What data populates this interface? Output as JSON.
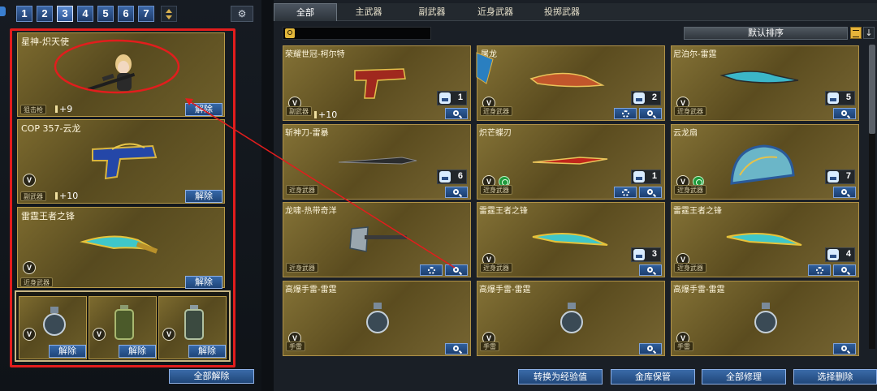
{
  "left": {
    "pages": [
      "1",
      "2",
      "3",
      "4",
      "5",
      "6",
      "7"
    ],
    "active_page": "3",
    "equipped": [
      {
        "name": "星神-炽天使",
        "category": "狙击枪",
        "plus": "+9"
      },
      {
        "name": "COP 357-云龙",
        "category": "副武器",
        "plus": "+10"
      },
      {
        "name": "雷霆王者之锋",
        "category": "近身武器",
        "plus": ""
      }
    ],
    "unequip_label": "解除",
    "all_unequip_label": "全部解除",
    "v_label": "V"
  },
  "right": {
    "tabs": [
      "全部",
      "主武器",
      "副武器",
      "近身武器",
      "投掷武器"
    ],
    "active_tab": "全部",
    "search_placeholder": "",
    "sort_label": "默认排序",
    "sort_dir": "↓",
    "cards": [
      {
        "name": "荣耀世冠-柯尔特",
        "category": "副武器",
        "plus": "+10",
        "count": "1"
      },
      {
        "name": "屠龙",
        "category": "近身武器",
        "count": "2"
      },
      {
        "name": "尼泊尔-雷霆",
        "category": "近身武器",
        "count": "5"
      },
      {
        "name": "斩神刀-雷暴",
        "category": "近身武器",
        "count": "6"
      },
      {
        "name": "炽芒蝶刃",
        "category": "近身武器",
        "count": "1"
      },
      {
        "name": "云龙扇",
        "category": "近身武器",
        "count": "7"
      },
      {
        "name": "龙啸-热带奇洋",
        "category": "近身武器",
        "count": ""
      },
      {
        "name": "雷霆王者之锋",
        "category": "近身武器",
        "count": "3"
      },
      {
        "name": "雷霆王者之锋",
        "category": "近身武器",
        "count": "4"
      },
      {
        "name": "高爆手雷-雷霆",
        "category": "手雷",
        "count": ""
      },
      {
        "name": "高爆手雷-雷霆",
        "category": "手雷",
        "count": ""
      },
      {
        "name": "高爆手雷-雷霆",
        "category": "手雷",
        "count": ""
      }
    ],
    "bottom_buttons": [
      "转换为经验值",
      "金库保管",
      "全部修理",
      "选择删除"
    ]
  },
  "colors": {
    "highlight_red": "#e21d1d",
    "button_blue": "#2d5594",
    "card_gold": "#847236"
  }
}
